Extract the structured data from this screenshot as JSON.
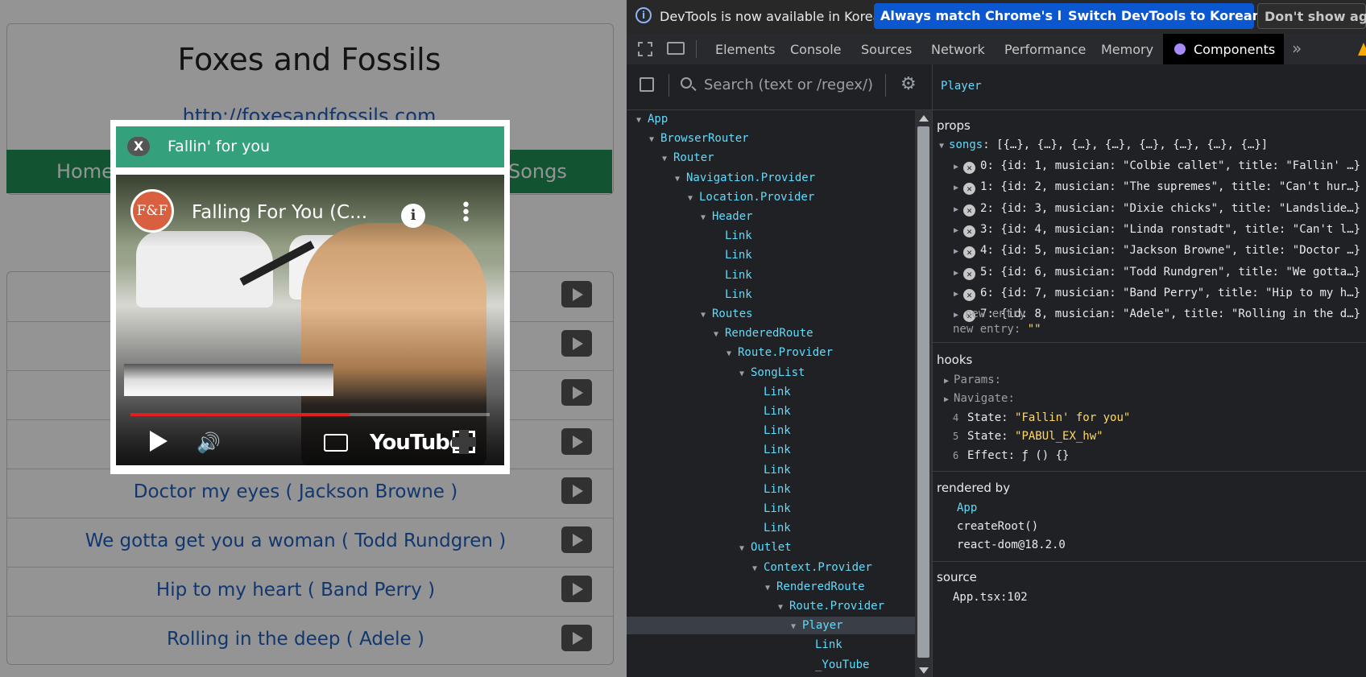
{
  "app": {
    "title": "Foxes and Fossils",
    "url": "http://foxesandfossils.com",
    "nav": {
      "home": "Home",
      "songs": "Songs"
    },
    "songs": [
      "",
      "",
      "",
      "",
      "Doctor my eyes ( Jackson Browne )",
      "We gotta get you a woman ( Todd Rundgren )",
      "Hip to my heart ( Band Perry )",
      "Rolling in the deep ( Adele )"
    ],
    "modal": {
      "close": "X",
      "title": "Fallin' for you",
      "video": {
        "avatar": "F&F",
        "title": "Falling For You (C...",
        "info": "i",
        "more": "⋮",
        "progress": 0.61,
        "brand": "YouTube",
        "volume_icon": "🔊"
      }
    }
  },
  "devtools": {
    "infobar": {
      "icon": "i",
      "message": "DevTools is now available in Korean!",
      "btn_match": "Always match Chrome's language",
      "btn_switch": "Switch DevTools to Korean",
      "btn_dont": "Don't show again"
    },
    "tabs": [
      "Elements",
      "Console",
      "Sources",
      "Network",
      "Performance",
      "Memory"
    ],
    "active_tab": "Components",
    "more": "»",
    "search_placeholder": "Search (text or /regex/)",
    "gear": "⚙",
    "tree": [
      {
        "label": "App",
        "depth": 0,
        "tri": "▼"
      },
      {
        "label": "BrowserRouter",
        "depth": 1,
        "tri": "▼"
      },
      {
        "label": "Router",
        "depth": 2,
        "tri": "▼"
      },
      {
        "label": "Navigation.Provider",
        "depth": 3,
        "tri": "▼"
      },
      {
        "label": "Location.Provider",
        "depth": 4,
        "tri": "▼"
      },
      {
        "label": "Header",
        "depth": 5,
        "tri": "▼"
      },
      {
        "label": "Link",
        "depth": 6,
        "tri": ""
      },
      {
        "label": "Link",
        "depth": 6,
        "tri": ""
      },
      {
        "label": "Link",
        "depth": 6,
        "tri": ""
      },
      {
        "label": "Link",
        "depth": 6,
        "tri": ""
      },
      {
        "label": "Routes",
        "depth": 5,
        "tri": "▼"
      },
      {
        "label": "RenderedRoute",
        "depth": 6,
        "tri": "▼"
      },
      {
        "label": "Route.Provider",
        "depth": 7,
        "tri": "▼"
      },
      {
        "label": "SongList",
        "depth": 8,
        "tri": "▼"
      },
      {
        "label": "Link",
        "depth": 9,
        "tri": ""
      },
      {
        "label": "Link",
        "depth": 9,
        "tri": ""
      },
      {
        "label": "Link",
        "depth": 9,
        "tri": ""
      },
      {
        "label": "Link",
        "depth": 9,
        "tri": ""
      },
      {
        "label": "Link",
        "depth": 9,
        "tri": ""
      },
      {
        "label": "Link",
        "depth": 9,
        "tri": ""
      },
      {
        "label": "Link",
        "depth": 9,
        "tri": ""
      },
      {
        "label": "Link",
        "depth": 9,
        "tri": ""
      },
      {
        "label": "Outlet",
        "depth": 8,
        "tri": "▼"
      },
      {
        "label": "Context.Provider",
        "depth": 9,
        "tri": "▼"
      },
      {
        "label": "RenderedRoute",
        "depth": 10,
        "tri": "▼"
      },
      {
        "label": "Route.Provider",
        "depth": 11,
        "tri": "▼"
      },
      {
        "label": "Player",
        "depth": 12,
        "tri": "▼",
        "selected": true
      },
      {
        "label": "Link",
        "depth": 13,
        "tri": ""
      },
      {
        "label": "_YouTube",
        "depth": 13,
        "tri": ""
      }
    ],
    "selected_component": "Player",
    "props": {
      "title": "props",
      "songs_key": "songs",
      "songs_summary": "[{…}, {…}, {…}, {…}, {…}, {…}, {…}, {…}]",
      "entries": [
        "0: {id: 1, musician: \"Colbie callet\", title: \"Fallin' …}",
        "1: {id: 2, musician: \"The supremes\", title: \"Can't hur…}",
        "2: {id: 3, musician: \"Dixie chicks\", title: \"Landslide…}",
        "3: {id: 4, musician: \"Linda ronstadt\", title: \"Can't l…}",
        "4: {id: 5, musician: \"Jackson Browne\", title: \"Doctor …}",
        "5: {id: 6, musician: \"Todd Rundgren\", title: \"We gotta…}",
        "6: {id: 7, musician: \"Band Perry\", title: \"Hip to my h…}",
        "7: {id: 8, musician: \"Adele\", title: \"Rolling in the d…}"
      ],
      "new_entry_placeholder": "new entry",
      "new_entry_key": "new entry",
      "new_entry_val": "\"\""
    },
    "hooks": {
      "title": "hooks",
      "params": "Params:",
      "navigate": "Navigate:",
      "state1_num": "4",
      "state1_key": "State:",
      "state1_val": "\"Fallin' for you\"",
      "state2_num": "5",
      "state2_key": "State:",
      "state2_val": "\"PABUl_EX_hw\"",
      "effect_num": "6",
      "effect_key": "Effect:",
      "effect_val": "ƒ () {}"
    },
    "rendered_by": {
      "title": "rendered by",
      "items": [
        "App",
        "createRoot()",
        "react-dom@18.2.0"
      ]
    },
    "source": {
      "title": "source",
      "file": "App.tsx:102"
    }
  }
}
